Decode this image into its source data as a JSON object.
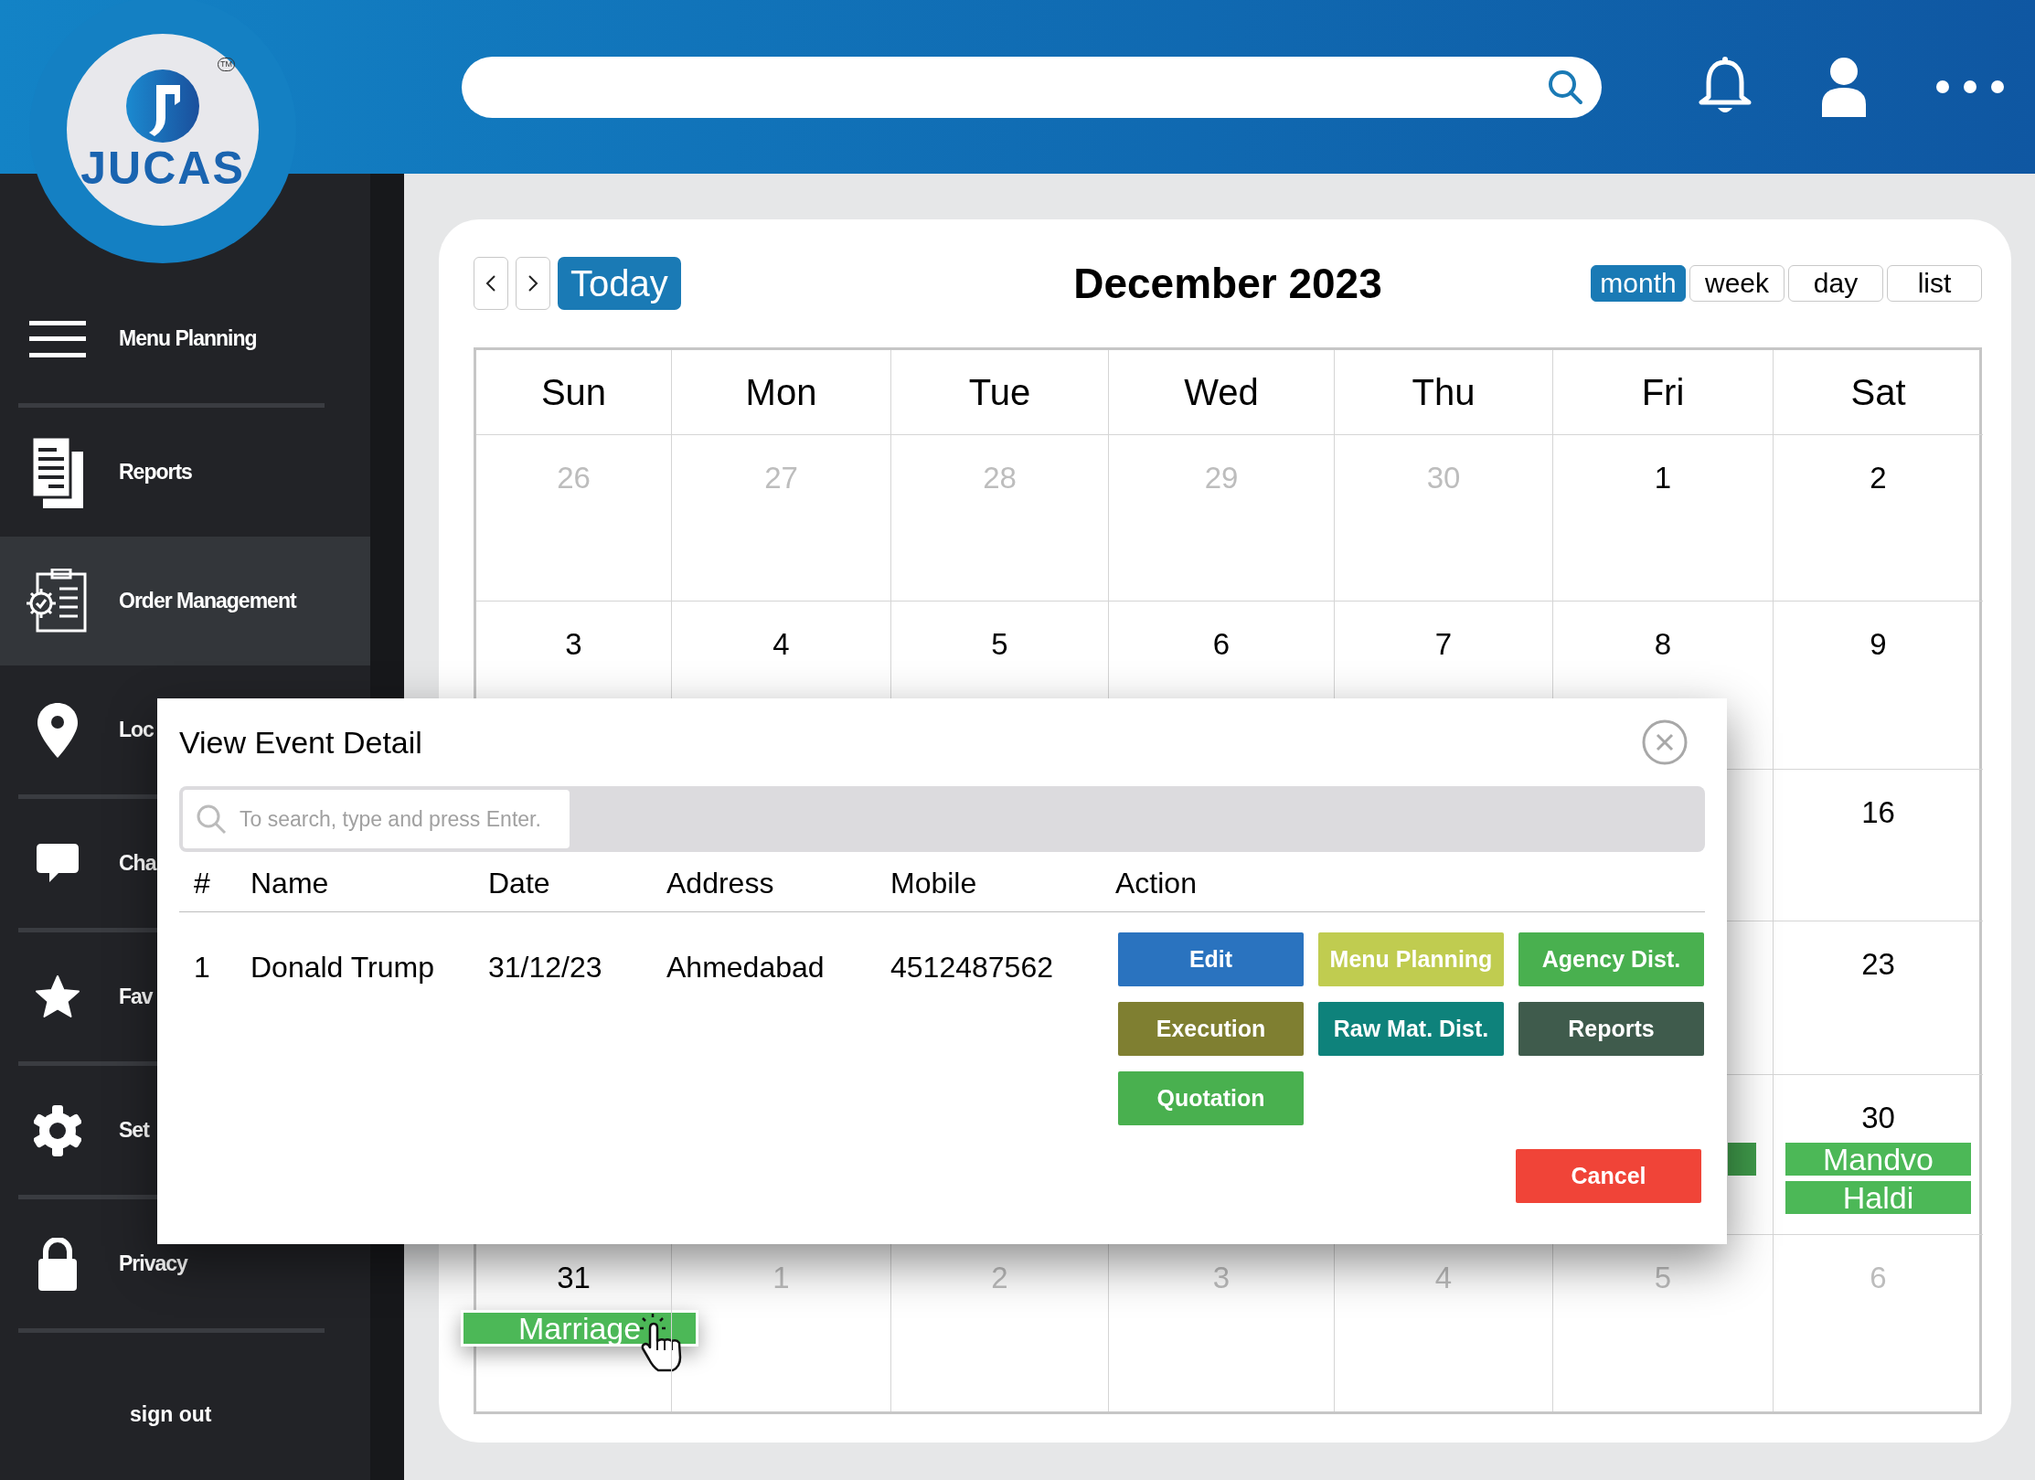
{
  "logo": {
    "name": "JUCAS",
    "mark": "TM"
  },
  "sidebar": {
    "items": [
      {
        "kind": "menu",
        "label": "Menu Planning",
        "selected": false
      },
      {
        "kind": "reports",
        "label": "Reports",
        "selected": false
      },
      {
        "kind": "orders",
        "label": "Order Management",
        "selected": true
      },
      {
        "kind": "location",
        "label": "Loc",
        "selected": false
      },
      {
        "kind": "chat",
        "label": "Cha",
        "selected": false
      },
      {
        "kind": "star",
        "label": "Fav",
        "selected": false
      },
      {
        "kind": "settings",
        "label": "Set",
        "selected": false
      },
      {
        "kind": "lock",
        "label": "Privacy",
        "selected": false
      }
    ],
    "sign_out": "sign out"
  },
  "calendar": {
    "today": "Today",
    "title": "December 2023",
    "views": [
      {
        "label": "month",
        "selected": true
      },
      {
        "label": "week",
        "selected": false
      },
      {
        "label": "day",
        "selected": false
      },
      {
        "label": "list",
        "selected": false
      }
    ],
    "weekdays": [
      "Sun",
      "Mon",
      "Tue",
      "Wed",
      "Thu",
      "Fri",
      "Sat"
    ],
    "weeks": [
      [
        {
          "day": "26",
          "muted": true
        },
        {
          "day": "27",
          "muted": true
        },
        {
          "day": "28",
          "muted": true
        },
        {
          "day": "29",
          "muted": true
        },
        {
          "day": "30",
          "muted": true
        },
        {
          "day": "1",
          "muted": false
        },
        {
          "day": "2",
          "muted": false
        }
      ],
      [
        {
          "day": "3",
          "muted": false
        },
        {
          "day": "4",
          "muted": false
        },
        {
          "day": "5",
          "muted": false
        },
        {
          "day": "6",
          "muted": false
        },
        {
          "day": "7",
          "muted": false
        },
        {
          "day": "8",
          "muted": false
        },
        {
          "day": "9",
          "muted": false
        }
      ],
      [
        {
          "day": "16",
          "muted": false
        }
      ],
      [
        {
          "day": "23",
          "muted": false
        }
      ],
      [
        {
          "events": [
            {
              "kind": "covered"
            }
          ]
        },
        {
          "day": "30",
          "muted": false,
          "events": [
            {
              "kind": "event",
              "label": "Mandvo"
            },
            {
              "kind": "event",
              "label": "Haldi"
            }
          ]
        }
      ],
      [
        {
          "day": "31",
          "muted": false,
          "events": [
            {
              "kind": "dragging",
              "label": "Marriage"
            }
          ]
        },
        {
          "day": "1",
          "muted": true
        },
        {
          "day": "2",
          "muted": true
        },
        {
          "day": "3",
          "muted": true
        },
        {
          "day": "4",
          "muted": true
        },
        {
          "day": "5",
          "muted": true
        },
        {
          "day": "6",
          "muted": true
        }
      ]
    ]
  },
  "modal": {
    "title": "View Event Detail",
    "search": {
      "placeholder": "To search, type and press Enter."
    },
    "columns": [
      "#",
      "Name",
      "Date",
      "Address",
      "Mobile",
      "Action"
    ],
    "rows": [
      {
        "cells": [
          "1",
          "Donald Trump",
          "31/12/23",
          "Ahmedabad",
          "4512487562"
        ],
        "actions": [
          {
            "label": "Edit",
            "color": "#2a73bf"
          },
          {
            "label": "Menu Planning",
            "color": "#c0cc50"
          },
          {
            "label": "Agency Dist.",
            "color": "#49b04f"
          },
          {
            "label": "Execution",
            "color": "#7f7f31"
          },
          {
            "label": "Raw Mat. Dist.",
            "color": "#0e827b"
          },
          {
            "label": "Reports",
            "color": "#3f5b4c"
          },
          {
            "label": "Quotation",
            "color": "#49b04f"
          }
        ]
      }
    ],
    "cancel": "Cancel"
  }
}
